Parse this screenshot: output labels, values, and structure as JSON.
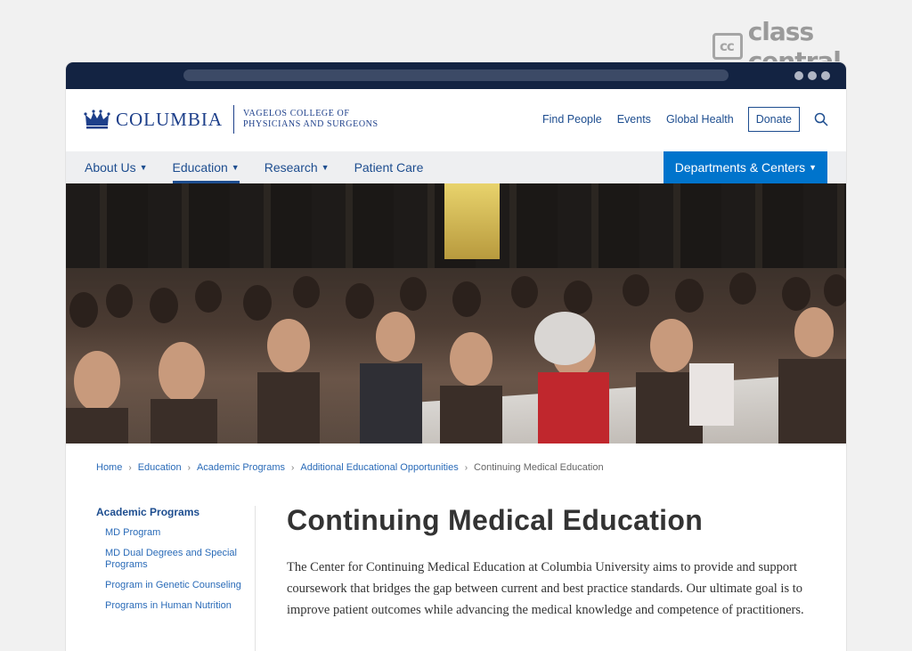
{
  "watermark": {
    "mark": "cc",
    "text": "class central"
  },
  "header": {
    "brand_name": "COLUMBIA",
    "brand_sub_line1": "Vagelos College of",
    "brand_sub_line2": "Physicians and Surgeons",
    "links": [
      "Find People",
      "Events",
      "Global Health"
    ],
    "donate_label": "Donate",
    "search_icon": "search-icon"
  },
  "nav": {
    "items": [
      {
        "label": "About Us",
        "has_dropdown": true
      },
      {
        "label": "Education",
        "has_dropdown": true,
        "active": true
      },
      {
        "label": "Research",
        "has_dropdown": true
      },
      {
        "label": "Patient Care",
        "has_dropdown": false
      }
    ],
    "departments_label": "Departments & Centers"
  },
  "breadcrumb": [
    "Home",
    "Education",
    "Academic Programs",
    "Additional Educational Opportunities",
    "Continuing Medical Education"
  ],
  "sidebar": {
    "heading": "Academic Programs",
    "links": [
      "MD Program",
      "MD Dual Degrees and Special Programs",
      "Program in Genetic Counseling",
      "Programs in Human Nutrition"
    ]
  },
  "main": {
    "title": "Continuing Medical Education",
    "intro": "The Center for Continuing Medical Education at Columbia University aims to provide and support coursework that bridges the gap between current and best practice standards. Our ultimate goal is to improve patient outcomes while advancing the medical knowledge and competence of practitioners."
  },
  "colors": {
    "navy": "#132342",
    "brand_blue": "#1d4d8f",
    "dept_blue": "#0074cc",
    "link_blue": "#2a6bb8"
  }
}
